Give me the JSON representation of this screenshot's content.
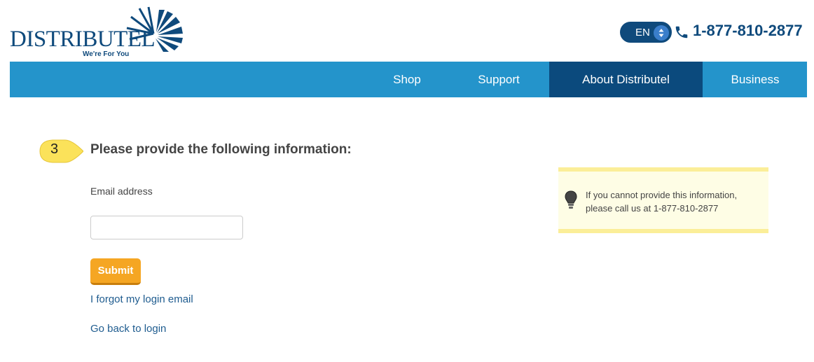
{
  "brand": {
    "name": "DISTRIBUTEL",
    "tagline": "We're For You",
    "color": "#0f4a7c"
  },
  "header": {
    "language": "EN",
    "phone": "1-877-810-2877"
  },
  "nav": {
    "items": [
      {
        "label": "Shop",
        "active": false
      },
      {
        "label": "Support",
        "active": false
      },
      {
        "label": "About Distributel",
        "active": true
      },
      {
        "label": "Business",
        "active": false
      }
    ],
    "bar_color": "#2494cb",
    "active_color": "#0b4a7d"
  },
  "form": {
    "step_number": "3",
    "heading": "Please provide the following information:",
    "email_label": "Email address",
    "email_value": "",
    "email_placeholder": "",
    "submit_label": "Submit",
    "forgot_link": "I forgot my login email",
    "back_link": "Go back to login"
  },
  "info": {
    "line1": "If you cannot provide this information,",
    "line2": "please call us at 1-877-810-2877",
    "icon": "lightbulb-icon"
  }
}
